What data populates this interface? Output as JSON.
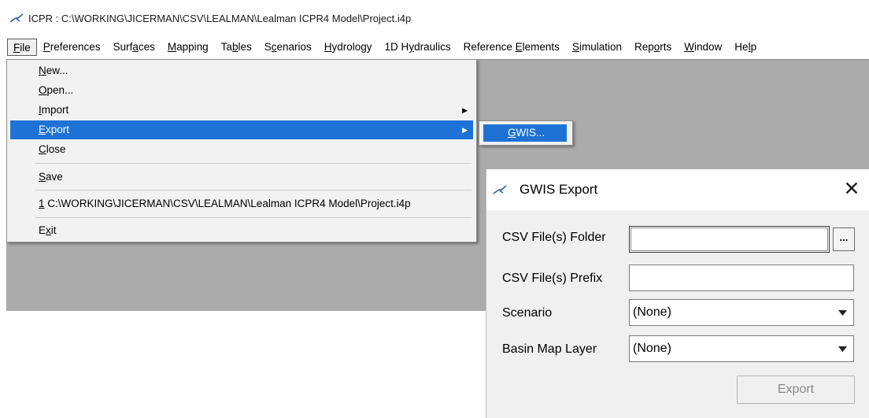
{
  "window": {
    "title": "ICPR : C:\\WORKING\\JICERMAN\\CSV\\LEALMAN\\Lealman ICPR4 Model\\Project.i4p",
    "app_icon": "icpr-icon"
  },
  "menubar": {
    "items": [
      {
        "label": "File",
        "active": true
      },
      {
        "label": "Preferences"
      },
      {
        "label": "Surfaces"
      },
      {
        "label": "Mapping"
      },
      {
        "label": "Tables"
      },
      {
        "label": "Scenarios"
      },
      {
        "label": "Hydrology"
      },
      {
        "label": "1D Hydraulics"
      },
      {
        "label": "Reference Elements"
      },
      {
        "label": "Simulation"
      },
      {
        "label": "Reports"
      },
      {
        "label": "Window"
      },
      {
        "label": "Help"
      }
    ]
  },
  "file_menu": {
    "items": [
      {
        "label": "New..."
      },
      {
        "label": "Open..."
      },
      {
        "label": "Import",
        "submenu": true
      },
      {
        "label": "Export",
        "submenu": true,
        "highlighted": true
      },
      {
        "label": "Close"
      },
      {
        "label": "Save"
      },
      {
        "label": "1 C:\\WORKING\\JICERMAN\\CSV\\LEALMAN\\Lealman ICPR4 Model\\Project.i4p"
      },
      {
        "label": "Exit"
      }
    ],
    "highlight_color": "#1f72d5"
  },
  "export_submenu": {
    "items": [
      {
        "label": "GWIS..."
      }
    ]
  },
  "gwis_dialog": {
    "title": "GWIS Export",
    "close_icon": "close-icon",
    "fields": {
      "csv_folder": {
        "label": "CSV File(s) Folder",
        "value": "",
        "browse_label": "..."
      },
      "csv_prefix": {
        "label": "CSV File(s) Prefix",
        "value": ""
      },
      "scenario": {
        "label": "Scenario",
        "selected": "(None)"
      },
      "basin_layer": {
        "label": "Basin Map Layer",
        "selected": "(None)"
      }
    },
    "export_button": {
      "label": "Export",
      "enabled": false
    }
  },
  "colors": {
    "workspace": "#ababab",
    "menu_bg": "#f2f2f2",
    "dialog_bg": "#f0f0f0",
    "heading_blue": "#1f7fd0"
  }
}
